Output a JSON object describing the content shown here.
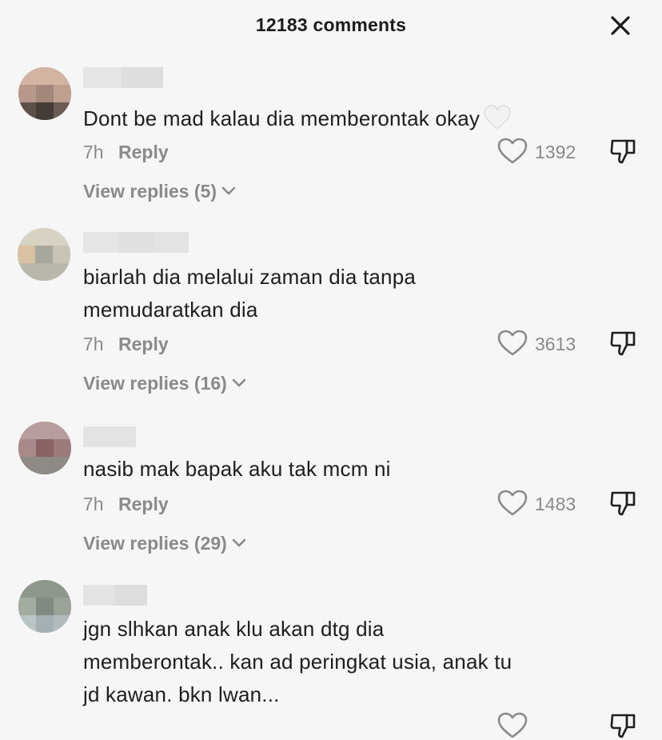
{
  "header": {
    "title": "12183 comments",
    "close_icon": "close-icon"
  },
  "comments": [
    {
      "text": "Dont be mad kalau dia memberontak okay",
      "emoji": "white-heart-emoji",
      "time": "7h",
      "reply_label": "Reply",
      "likes": "1392",
      "view_replies": "View replies (5)"
    },
    {
      "text": "biarlah dia melalui zaman dia tanpa\nmemudaratkan dia",
      "time": "7h",
      "reply_label": "Reply",
      "likes": "3613",
      "view_replies": "View replies (16)"
    },
    {
      "text": "nasib mak bapak aku tak mcm ni",
      "time": "7h",
      "reply_label": "Reply",
      "likes": "1483",
      "view_replies": "View replies (29)"
    },
    {
      "text": "jgn slhkan anak klu akan dtg dia\nmemberontak.. kan ad peringkat usia, anak tu\njd kawan. bkn lwan..."
    }
  ],
  "colors": {
    "background": "#f6f6f6",
    "text": "#1e1e1e",
    "muted": "#8a8a8a"
  }
}
